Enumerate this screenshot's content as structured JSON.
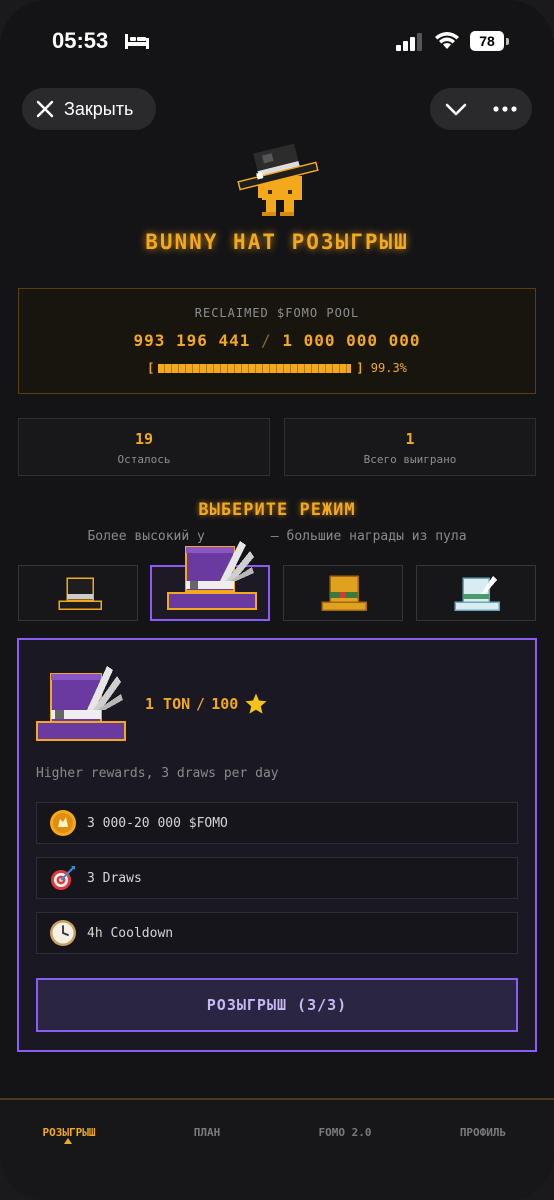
{
  "status": {
    "time": "05:53",
    "battery": "78"
  },
  "header": {
    "close_label": "Закрыть"
  },
  "title": "BUNNY HAT РОЗЫГРЫШ",
  "pool": {
    "label": "RECLAIMED $FOMO POOL",
    "current": "993 196 441",
    "total": "1 000 000 000",
    "progress": 0.993,
    "percent": "99.3%"
  },
  "stats": [
    {
      "value": "19",
      "label": "Осталось"
    },
    {
      "value": "1",
      "label": "Всего выиграно"
    }
  ],
  "mode": {
    "title": "ВЫБЕРИТЕ РЕЖИМ",
    "subtitle_start": "Более высокий у",
    "subtitle_end": "— большие награды из пула",
    "options": [
      {
        "icon": "black-top-hat-icon",
        "selected": false
      },
      {
        "icon": "purple-feather-hat-icon",
        "selected": true
      },
      {
        "icon": "gold-top-hat-icon",
        "selected": false
      },
      {
        "icon": "crystal-top-hat-icon",
        "selected": false
      }
    ]
  },
  "card": {
    "price_ton": "1 TON",
    "price_stars": "100",
    "description": "Higher rewards, 3 draws per day",
    "features": [
      {
        "icon": "fomo-coin-icon",
        "text": "3 000-20 000 $FOMO"
      },
      {
        "icon": "target-icon",
        "text": "3 Draws"
      },
      {
        "icon": "clock-icon",
        "text": "4h Cooldown"
      }
    ],
    "button_label": "РОЗЫГРЫШ (3/3)"
  },
  "nav": {
    "items": [
      {
        "label": "РОЗЫГРЫШ",
        "active": true
      },
      {
        "label": "ПЛАН",
        "active": false
      },
      {
        "label": "FOMO 2.0",
        "active": false
      },
      {
        "label": "ПРОФИЛЬ",
        "active": false
      }
    ]
  },
  "colors": {
    "accent": "#f4a81c",
    "purple": "#8b5cf6",
    "background": "#141416"
  }
}
